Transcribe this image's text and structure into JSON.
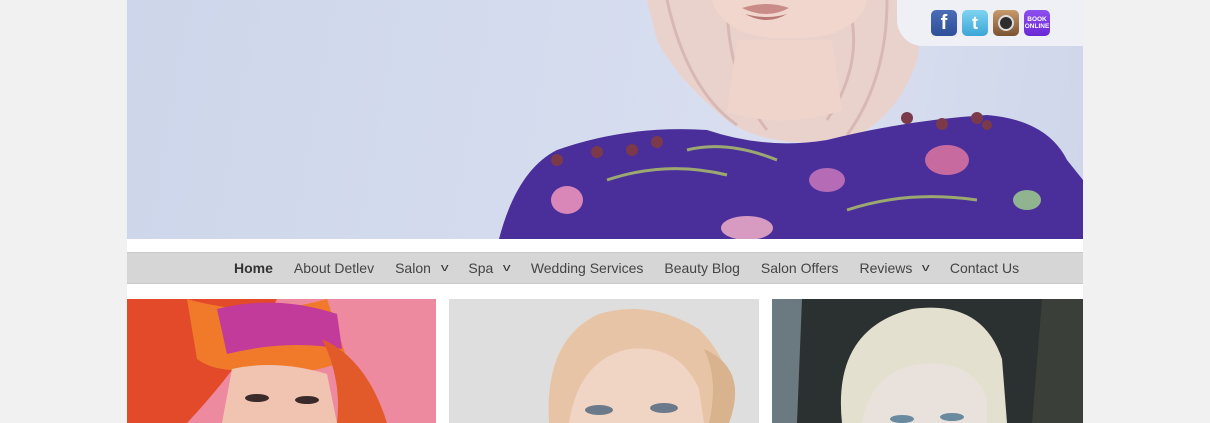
{
  "social": {
    "facebook_glyph": "f",
    "twitter_glyph": "t",
    "book_line1": "BOOK",
    "book_line2": "ONLINE",
    "icons": [
      "facebook-icon",
      "twitter-icon",
      "instagram-icon",
      "book-online-icon"
    ]
  },
  "nav": {
    "items": [
      {
        "label": "Home",
        "active": true,
        "has_dropdown": false
      },
      {
        "label": "About Detlev",
        "has_dropdown": false
      },
      {
        "label": "Salon",
        "has_dropdown": true
      },
      {
        "label": "Spa",
        "has_dropdown": true
      },
      {
        "label": "Wedding Services",
        "has_dropdown": false
      },
      {
        "label": "Beauty Blog",
        "has_dropdown": false
      },
      {
        "label": "Salon Offers",
        "has_dropdown": false
      },
      {
        "label": "Reviews",
        "has_dropdown": true
      },
      {
        "label": "Contact Us",
        "has_dropdown": false
      }
    ],
    "dropdown_glyph": "v"
  },
  "colors": {
    "background": "#f1f1f1",
    "nav_bar": "#d6d6d6",
    "hero_sky": "#d4dbee",
    "dress_purple": "#4a2f9a"
  }
}
